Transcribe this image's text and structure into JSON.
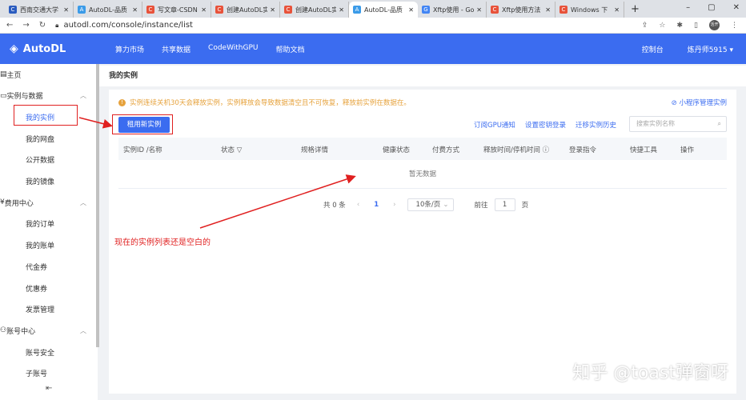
{
  "browser": {
    "tabs": [
      {
        "title": "西南交通大学",
        "icon": "C",
        "color": "#2b5cbf"
      },
      {
        "title": "AutoDL-品质",
        "icon": "A",
        "color": "#3b9be8"
      },
      {
        "title": "写文章-CSDN",
        "icon": "C",
        "color": "#e8523a"
      },
      {
        "title": "创建AutoDL实",
        "icon": "C",
        "color": "#e8523a"
      },
      {
        "title": "创建AutoDL实",
        "icon": "C",
        "color": "#e8523a"
      },
      {
        "title": "AutoDL-品质",
        "icon": "A",
        "color": "#3b9be8",
        "active": true
      },
      {
        "title": "Xftp使用 - Go",
        "icon": "G",
        "color": "#4285f4"
      },
      {
        "title": "Xftp使用方法",
        "icon": "C",
        "color": "#e8523a"
      },
      {
        "title": "Windows 下",
        "icon": "C",
        "color": "#e8523a"
      }
    ],
    "url": "autodl.com/console/instance/list",
    "avatar": "活开"
  },
  "header": {
    "logo": "AutoDL",
    "nav": [
      "算力市场",
      "共享数据",
      "CodeWithGPU",
      "帮助文档"
    ],
    "console": "控制台",
    "user": "炼丹师5915 ▾"
  },
  "sidebar": {
    "items": [
      {
        "label": "主页",
        "type": "group",
        "icon": "home-icon"
      },
      {
        "label": "实例与数据",
        "type": "group",
        "icon": "folder-icon"
      },
      {
        "label": "我的实例",
        "type": "sub",
        "active": true
      },
      {
        "label": "我的网盘",
        "type": "sub"
      },
      {
        "label": "公开数据",
        "type": "sub"
      },
      {
        "label": "我的镜像",
        "type": "sub"
      },
      {
        "label": "费用中心",
        "type": "group",
        "icon": "yen-icon"
      },
      {
        "label": "我的订单",
        "type": "sub"
      },
      {
        "label": "我的账单",
        "type": "sub"
      },
      {
        "label": "代金券",
        "type": "sub"
      },
      {
        "label": "优惠券",
        "type": "sub"
      },
      {
        "label": "发票管理",
        "type": "sub"
      },
      {
        "label": "账号中心",
        "type": "group",
        "icon": "user-icon"
      },
      {
        "label": "账号安全",
        "type": "sub"
      },
      {
        "label": "子账号",
        "type": "sub"
      }
    ]
  },
  "main": {
    "title": "我的实例",
    "notice": "实例连续关机30天会释放实例，实例释放会导致数据清空且不可恢复，释放前实例在数据在。",
    "mini_program": "小程序管理实例",
    "new_instance": "租用新实例",
    "links": [
      "订阅GPU通知",
      "设置密钥登录",
      "迁移实例历史"
    ],
    "search_placeholder": "搜索实例名称",
    "columns": [
      "实例ID /名称",
      "状态",
      "规格详情",
      "健康状态",
      "付费方式",
      "释放时间/停机时间",
      "登录指令",
      "快捷工具",
      "操作"
    ],
    "empty": "暂无数据",
    "pager": {
      "total": "共 0 条",
      "page": "1",
      "page_size": "10条/页",
      "goto": "前往",
      "goto_value": "1",
      "page_unit": "页"
    }
  },
  "annotation": "现在的实例列表还是空白的",
  "watermark": "知乎 @toast弹窗呀",
  "colors": {
    "brand": "#3b6cf0",
    "warning": "#e6a23c",
    "annotation": "#e02020"
  }
}
